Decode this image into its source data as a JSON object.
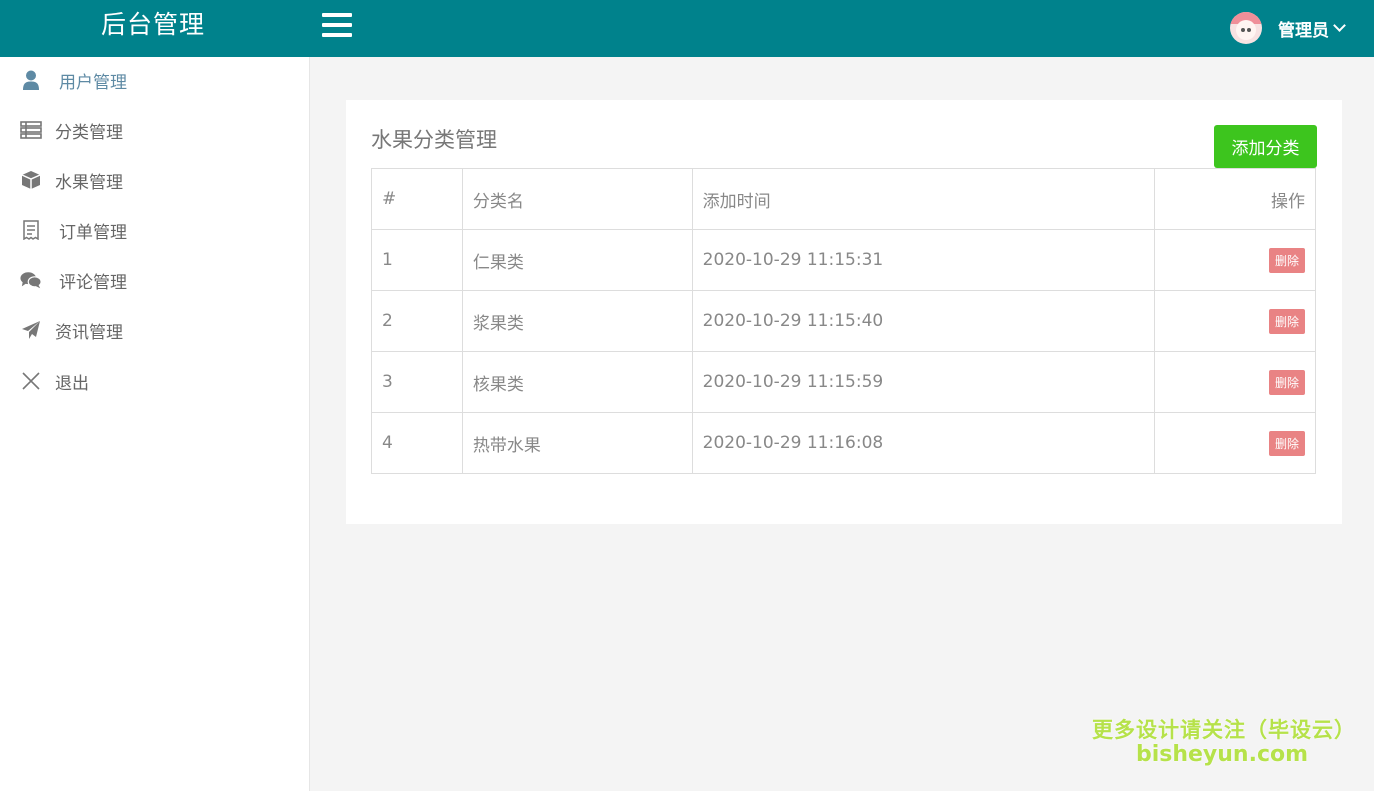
{
  "header": {
    "brand": "后台管理",
    "user_name": "管理员"
  },
  "sidebar": {
    "items": [
      {
        "label": "用户管理",
        "icon": "user-icon"
      },
      {
        "label": "分类管理",
        "icon": "list-icon"
      },
      {
        "label": "水果管理",
        "icon": "cube-icon"
      },
      {
        "label": "订单管理",
        "icon": "receipt-icon"
      },
      {
        "label": "评论管理",
        "icon": "comments-icon"
      },
      {
        "label": "资讯管理",
        "icon": "paper-plane-icon"
      },
      {
        "label": "退出",
        "icon": "close-icon"
      }
    ]
  },
  "main": {
    "title": "水果分类管理",
    "add_button": "添加分类",
    "table": {
      "headers": [
        "#",
        "分类名",
        "添加时间",
        "操作"
      ],
      "rows": [
        {
          "id": "1",
          "name": "仁果类",
          "time": "2020-10-29 11:15:31",
          "action": "删除"
        },
        {
          "id": "2",
          "name": "浆果类",
          "time": "2020-10-29 11:15:40",
          "action": "删除"
        },
        {
          "id": "3",
          "name": "核果类",
          "time": "2020-10-29 11:15:59",
          "action": "删除"
        },
        {
          "id": "4",
          "name": "热带水果",
          "time": "2020-10-29 11:16:08",
          "action": "删除"
        }
      ]
    }
  },
  "watermark": {
    "line1": "更多设计请关注（毕设云）",
    "line2": "bisheyun.com"
  },
  "colors": {
    "header_bg": "#00828c",
    "add_button": "#3dc51e",
    "delete_button": "#e98384",
    "active_nav": "#5e8aa4"
  }
}
